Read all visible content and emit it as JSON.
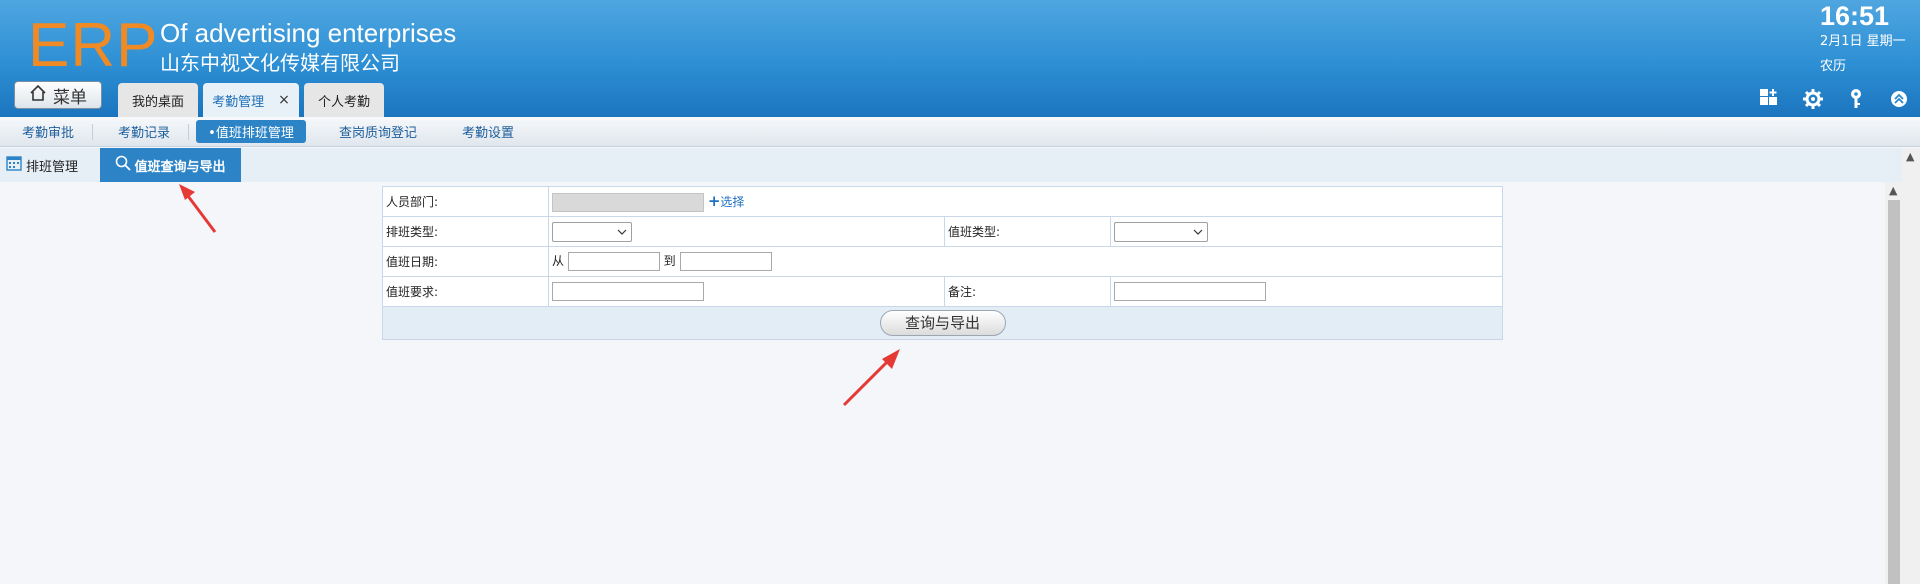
{
  "header": {
    "logo": "ERP",
    "company_en": "Of advertising enterprises",
    "company_cn": "山东中视文化传媒有限公司",
    "menu_label": "菜单",
    "time": "16:51",
    "date": "2月1日 星期一",
    "lunar": "农历"
  },
  "tabs": [
    {
      "label": "我的桌面",
      "active": false
    },
    {
      "label": "考勤管理",
      "active": true,
      "closable": true
    },
    {
      "label": "个人考勤",
      "active": false
    }
  ],
  "tab_close_symbol": "×",
  "subnav": [
    {
      "label": "考勤审批"
    },
    {
      "label": "考勤记录"
    },
    {
      "label": "•值班排班管理",
      "active": true
    },
    {
      "label": "查岗质询登记"
    },
    {
      "label": "考勤设置"
    }
  ],
  "inner_tabs": [
    {
      "label": "排班管理",
      "icon": "calendar-icon"
    },
    {
      "label": "值班查询与导出",
      "icon": "search-icon",
      "active": true
    }
  ],
  "form": {
    "dept_label": "人员部门:",
    "select_link": "选择",
    "shift_type_label": "排班类型:",
    "duty_type_label": "值班类型:",
    "date_label": "值班日期:",
    "from_label": "从",
    "to_label": "到",
    "requirement_label": "值班要求:",
    "remark_label": "备注:",
    "submit_label": "查询与导出"
  },
  "colors": {
    "header_blue": "#2d8fd4",
    "logo_orange": "#f08a24",
    "accent_blue": "#2c84c7",
    "annotation_red": "#e53935"
  }
}
